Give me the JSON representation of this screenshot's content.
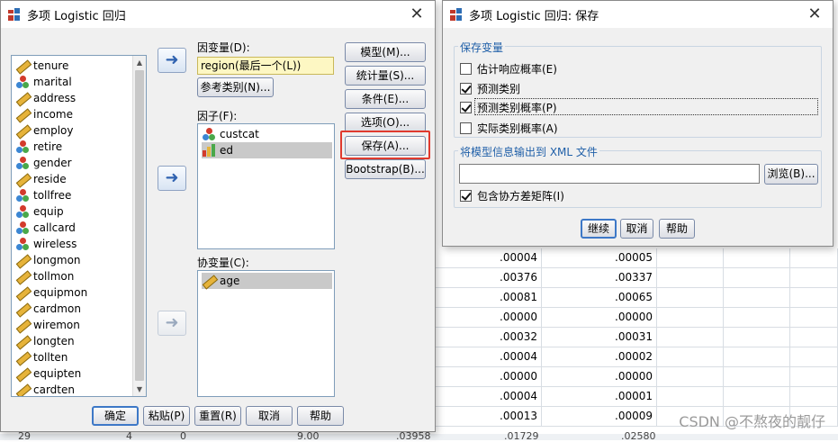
{
  "grid": {
    "rows": [
      {
        "a": ".00004",
        "b": ".00005"
      },
      {
        "a": ".00376",
        "b": ".00337"
      },
      {
        "a": ".00081",
        "b": ".00065"
      },
      {
        "a": ".00000",
        "b": ".00000"
      },
      {
        "a": ".00032",
        "b": ".00031"
      },
      {
        "a": ".00004",
        "b": ".00002"
      },
      {
        "a": ".00000",
        "b": ".00000"
      },
      {
        "a": ".00004",
        "b": ".00001"
      },
      {
        "a": ".00013",
        "b": ".00009"
      }
    ],
    "bottom": [
      "29",
      "4",
      "0",
      "9.00",
      ".03958",
      ".01729",
      ".02580"
    ]
  },
  "main_dialog": {
    "title": "多项 Logistic 回归",
    "close": "✕",
    "variables": [
      {
        "name": "tenure",
        "type": "scale"
      },
      {
        "name": "marital",
        "type": "nominal"
      },
      {
        "name": "address",
        "type": "scale"
      },
      {
        "name": "income",
        "type": "scale"
      },
      {
        "name": "employ",
        "type": "scale"
      },
      {
        "name": "retire",
        "type": "nominal"
      },
      {
        "name": "gender",
        "type": "nominal"
      },
      {
        "name": "reside",
        "type": "scale"
      },
      {
        "name": "tollfree",
        "type": "nominal"
      },
      {
        "name": "equip",
        "type": "nominal"
      },
      {
        "name": "callcard",
        "type": "nominal"
      },
      {
        "name": "wireless",
        "type": "nominal"
      },
      {
        "name": "longmon",
        "type": "scale"
      },
      {
        "name": "tollmon",
        "type": "scale"
      },
      {
        "name": "equipmon",
        "type": "scale"
      },
      {
        "name": "cardmon",
        "type": "scale"
      },
      {
        "name": "wiremon",
        "type": "scale"
      },
      {
        "name": "longten",
        "type": "scale"
      },
      {
        "name": "tollten",
        "type": "scale"
      },
      {
        "name": "equipten",
        "type": "scale"
      },
      {
        "name": "cardten",
        "type": "scale"
      }
    ],
    "dependent_label": "因变量(D):",
    "dependent_value": "region(最后一个(L))",
    "reference_button": "参考类别(N)...",
    "factor_label": "因子(F):",
    "factors": [
      {
        "name": "custcat",
        "type": "nominal"
      },
      {
        "name": "ed",
        "type": "ordinal"
      }
    ],
    "covariate_label": "协变量(C):",
    "covariates": [
      {
        "name": "age",
        "type": "scale"
      }
    ],
    "side_buttons": {
      "model": "模型(M)...",
      "statistics": "统计量(S)...",
      "criteria": "条件(E)...",
      "options": "选项(O)...",
      "save": "保存(A)...",
      "bootstrap": "Bootstrap(B)..."
    },
    "bottom_buttons": {
      "ok": "确定",
      "paste": "粘贴(P)",
      "reset": "重置(R)",
      "cancel": "取消",
      "help": "帮助"
    }
  },
  "save_dialog": {
    "title": "多项 Logistic 回归: 保存",
    "close": "✕",
    "group_save_title": "保存变量",
    "checkboxes": [
      {
        "label": "估计响应概率(E)",
        "checked": false
      },
      {
        "label": "预测类别",
        "checked": true
      },
      {
        "label": "预测类别概率(P)",
        "checked": true
      },
      {
        "label": "实际类别概率(A)",
        "checked": false
      }
    ],
    "group_xml_title": "将模型信息输出到 XML 文件",
    "xml_path": "",
    "browse_button": "浏览(B)...",
    "include_cov": {
      "label": "包含协方差矩阵(I)",
      "checked": true
    },
    "buttons": {
      "continue": "继续",
      "cancel": "取消",
      "help": "帮助"
    }
  },
  "watermark": "CSDN @不熬夜的靓仔"
}
